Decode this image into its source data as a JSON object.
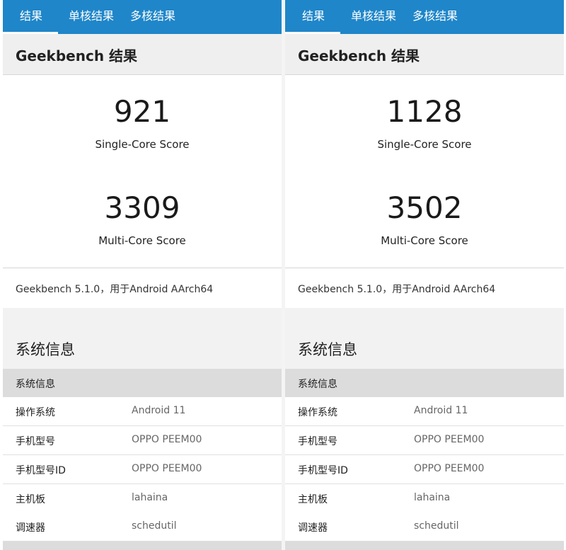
{
  "panels": [
    {
      "tabs": [
        "结果",
        "单核结果",
        "多核结果"
      ],
      "active_tab": 0,
      "header_title": "Geekbench 结果",
      "single_core": {
        "value": "921",
        "label": "Single-Core Score"
      },
      "multi_core": {
        "value": "3309",
        "label": "Multi-Core Score"
      },
      "version": "Geekbench 5.1.0，用于Android AArch64",
      "section_title": "系统信息",
      "table_header": "系统信息",
      "rows": [
        {
          "key": "操作系统",
          "value": "Android 11"
        },
        {
          "key": "手机型号",
          "value": "OPPO PEEM00"
        },
        {
          "key": "手机型号ID",
          "value": "OPPO PEEM00"
        },
        {
          "key": "主机板",
          "value": "lahaina"
        },
        {
          "key": "调速器",
          "value": "schedutil"
        }
      ]
    },
    {
      "tabs": [
        "结果",
        "单核结果",
        "多核结果"
      ],
      "active_tab": 0,
      "header_title": "Geekbench 结果",
      "single_core": {
        "value": "1128",
        "label": "Single-Core Score"
      },
      "multi_core": {
        "value": "3502",
        "label": "Multi-Core Score"
      },
      "version": "Geekbench 5.1.0，用于Android AArch64",
      "section_title": "系统信息",
      "table_header": "系统信息",
      "rows": [
        {
          "key": "操作系统",
          "value": "Android 11"
        },
        {
          "key": "手机型号",
          "value": "OPPO PEEM00"
        },
        {
          "key": "手机型号ID",
          "value": "OPPO PEEM00"
        },
        {
          "key": "主机板",
          "value": "lahaina"
        },
        {
          "key": "调速器",
          "value": "schedutil"
        }
      ]
    }
  ],
  "colors": {
    "tab_bar": "#1f86c9",
    "header_bg": "#efefef",
    "table_header_bg": "#dcdcdc"
  }
}
